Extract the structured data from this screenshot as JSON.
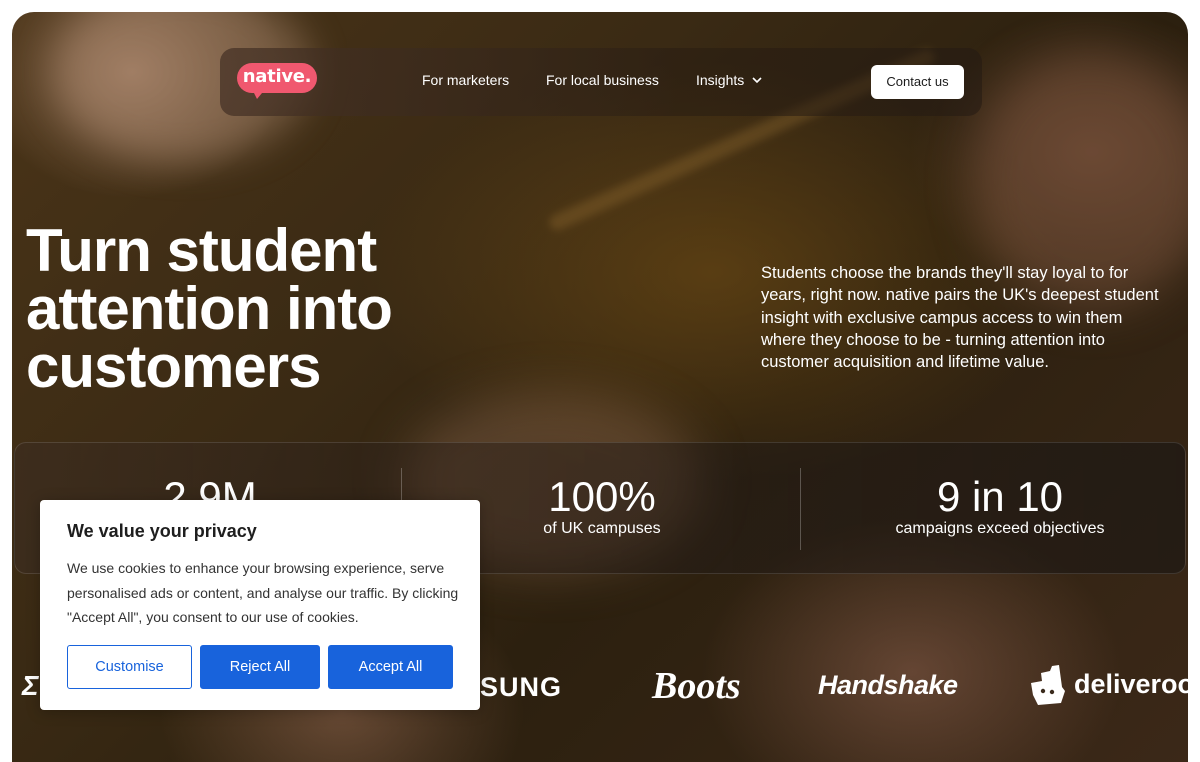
{
  "nav": {
    "logo_text": "native.",
    "links": [
      {
        "label": "For marketers"
      },
      {
        "label": "For local business"
      },
      {
        "label": "Insights"
      }
    ],
    "contact_label": "Contact us"
  },
  "hero": {
    "title": "Turn student attention into customers",
    "description": "Students choose the brands they'll stay loyal to for years, right now. native pairs the UK's deepest student insight with exclusive campus access to win them where they choose to be - turning attention into customer acquisition and lifetime value."
  },
  "stats": [
    {
      "value": "2.9M",
      "label": ""
    },
    {
      "value": "100%",
      "label": "of UK campuses"
    },
    {
      "value": "9 in 10",
      "label": "campaigns exceed objectives"
    }
  ],
  "brands": {
    "left_partial": "Σ",
    "samsung": "SUNG",
    "boots": "Boots",
    "handshake": "Handshake",
    "deliveroo": "deliveroo"
  },
  "cookie": {
    "title": "We value your privacy",
    "text": "We use cookies to enhance your browsing experience, serve personalised ads or content, and analyse our traffic. By clicking \"Accept All\", you consent to our use of cookies.",
    "customise_label": "Customise",
    "reject_label": "Reject All",
    "accept_label": "Accept All"
  },
  "colors": {
    "logo": "#f0586f",
    "cookie_button": "#1863dc"
  }
}
